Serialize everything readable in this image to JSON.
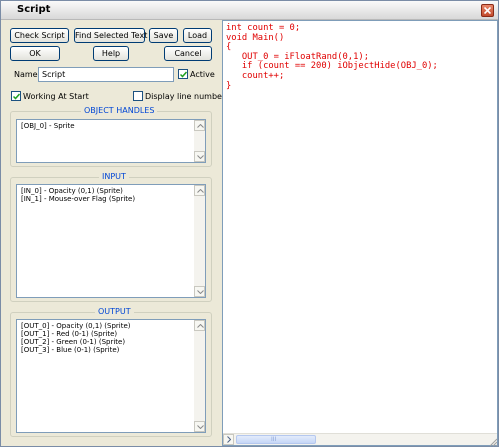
{
  "window": {
    "title": "Script"
  },
  "toolbar": {
    "check_script": "Check Script",
    "find_selected": "Find Selected Text",
    "save": "Save",
    "load": "Load",
    "ok": "OK",
    "help": "Help",
    "cancel": "Cancel"
  },
  "fields": {
    "name_label": "Name:",
    "name_value": "Script",
    "active_label": "Active",
    "active_checked": true,
    "working_at_start_label": "Working At Start",
    "working_at_start_checked": true,
    "display_line_numbers_label": "Display line numbers",
    "display_line_numbers_checked": false
  },
  "object_handles": {
    "title": "OBJECT HANDLES",
    "items": [
      "[OBJ_0] - Sprite"
    ]
  },
  "input": {
    "title": "INPUT",
    "items": [
      "[IN_0] - Opacity (0,1) (Sprite)",
      "[IN_1] - Mouse-over Flag (Sprite)"
    ]
  },
  "output": {
    "title": "OUTPUT",
    "items": [
      "[OUT_0] - Opacity (0,1) (Sprite)",
      "[OUT_1] - Red (0-1) (Sprite)",
      "[OUT_2] - Green (0-1) (Sprite)",
      "[OUT_3] - Blue (0-1) (Sprite)"
    ]
  },
  "editor": {
    "lines": [
      "int count = 0;",
      "void Main()",
      "{",
      "   OUT_0 = iFloatRand(0,1);",
      "   if (count == 200) iObjectHide(OBJ_0);",
      "   count++;",
      "}"
    ],
    "text_color": "#e00000",
    "scrollbar_thumb_label": "III"
  },
  "colors": {
    "group_title": "#0046d5",
    "window_bg": "#ece9d8",
    "close_button": "#c24a2c"
  }
}
